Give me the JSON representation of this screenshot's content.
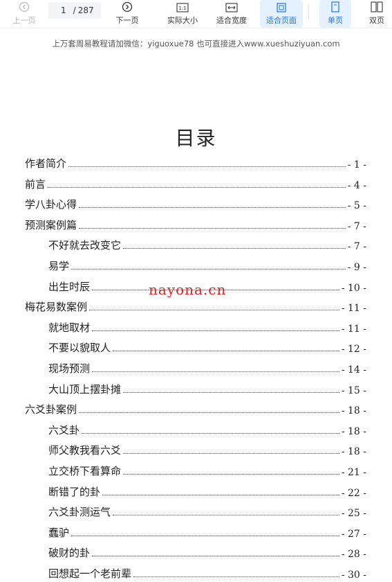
{
  "toolbar": {
    "prev_label": "上一页",
    "page_current": "1",
    "page_sep": "/",
    "page_total": "287",
    "next_label": "下一页",
    "actual_size_label": "实际大小",
    "actual_size_icon_text": "1:1",
    "fit_width_label": "适合宽度",
    "fit_page_label": "适合页面",
    "single_page_label": "单页",
    "double_page_label": "双页"
  },
  "page": {
    "notice": "上万套周易教程请加微信：yiguoxue78  也可直接进入www.xueshuziyuan.com",
    "title": "目录",
    "watermark": "nayona.cn"
  },
  "toc": [
    {
      "title": "作者简介",
      "page": "- 1 -",
      "level": 1
    },
    {
      "title": "前言",
      "page": "- 4 -",
      "level": 1
    },
    {
      "title": "学八卦心得",
      "page": "- 5 -",
      "level": 1
    },
    {
      "title": "预测案例篇",
      "page": "- 7 -",
      "level": 1
    },
    {
      "title": "不好就去改变它",
      "page": "- 7 -",
      "level": 2
    },
    {
      "title": "易学",
      "page": "- 9 -",
      "level": 2
    },
    {
      "title": "出生时辰",
      "page": "- 10 -",
      "level": 2
    },
    {
      "title": "梅花易数案例",
      "page": "- 11 -",
      "level": 1
    },
    {
      "title": "就地取材",
      "page": "- 11 -",
      "level": 2
    },
    {
      "title": "不要以貌取人",
      "page": "- 12 -",
      "level": 2
    },
    {
      "title": "现场预测",
      "page": "- 14 -",
      "level": 2
    },
    {
      "title": "大山顶上摆卦摊",
      "page": "- 15 -",
      "level": 2
    },
    {
      "title": "六爻卦案例",
      "page": "- 18 -",
      "level": 1
    },
    {
      "title": "六爻卦",
      "page": "- 18 -",
      "level": 2
    },
    {
      "title": "师父教我看六爻",
      "page": "- 18 -",
      "level": 2
    },
    {
      "title": "立交桥下看算命",
      "page": "- 21 -",
      "level": 2
    },
    {
      "title": "断错了的卦",
      "page": "- 22 -",
      "level": 2
    },
    {
      "title": "六爻卦测运气",
      "page": "- 25 -",
      "level": 2
    },
    {
      "title": "蠢驴",
      "page": "- 27 -",
      "level": 2
    },
    {
      "title": "破财的卦",
      "page": "- 28 -",
      "level": 2
    },
    {
      "title": "回想起一个老前辈",
      "page": "- 30 -",
      "level": 2
    }
  ]
}
